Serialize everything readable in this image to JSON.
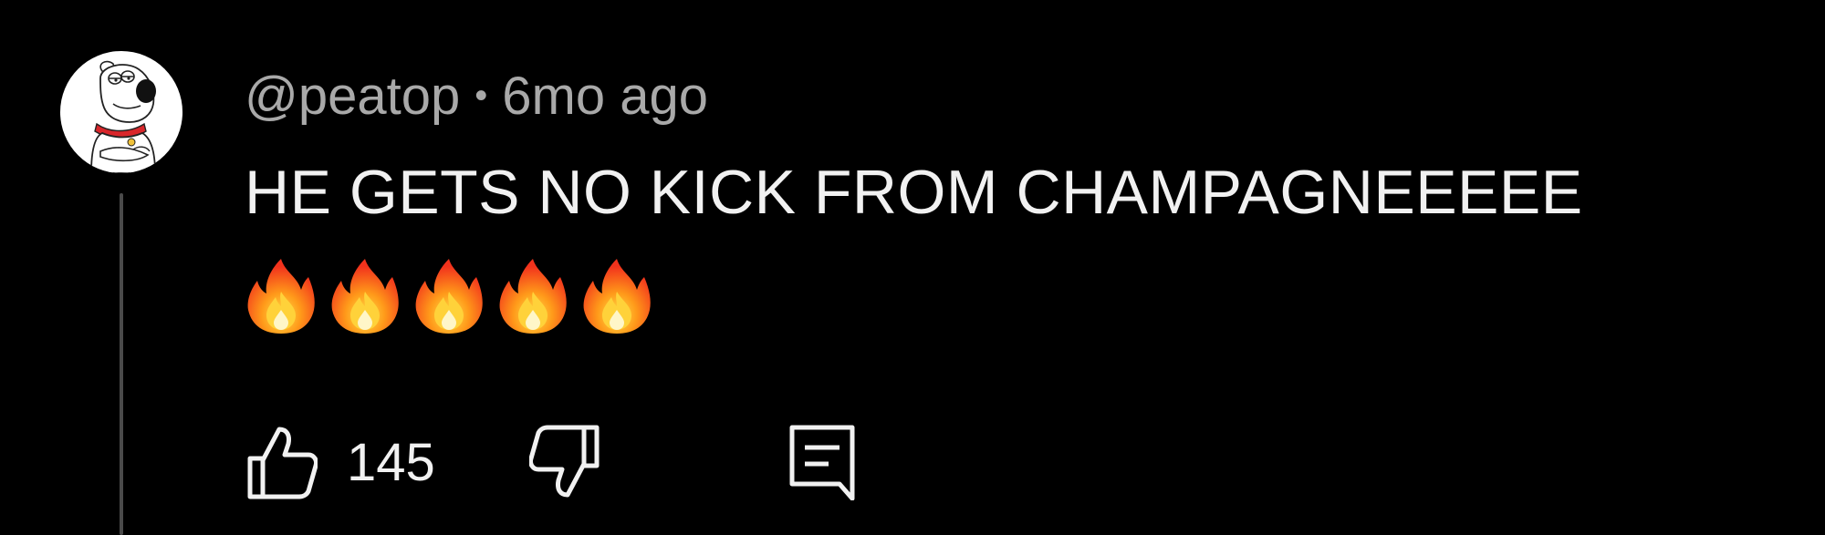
{
  "comment": {
    "author": "@peatop",
    "separator": "•",
    "timestamp": "6mo ago",
    "text": "HE GETS NO KICK FROM CHAMPAGNEEEEE",
    "emojis": [
      "fire",
      "fire",
      "fire",
      "fire",
      "fire"
    ],
    "like_count": "145"
  },
  "icons": {
    "like": "thumbs-up-icon",
    "dislike": "thumbs-down-icon",
    "reply": "comment-reply-icon",
    "avatar": "cartoon-dog-avatar"
  },
  "colors": {
    "background": "#000000",
    "primary_text": "#f1f1f1",
    "secondary_text": "#a9a9a9",
    "thread_line": "#4a4a4a"
  }
}
